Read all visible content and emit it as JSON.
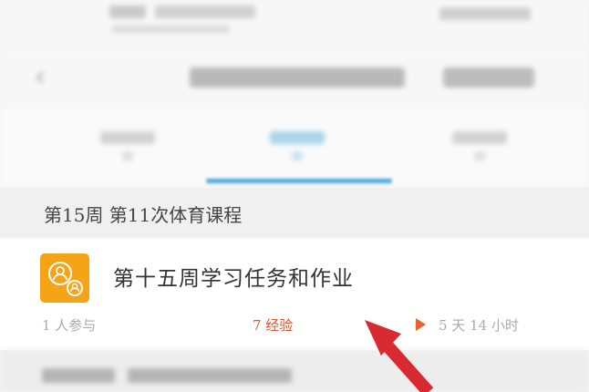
{
  "section": {
    "title": "第15周  第11次体育课程"
  },
  "task": {
    "icon": "task-group-icon",
    "title": "第十五周学习任务和作业",
    "participants": "1 人参与",
    "experience": "7 经验",
    "deadline": "5 天 14 小时"
  },
  "colors": {
    "accent_orange": "#f5a418",
    "experience_red": "#d05b30",
    "tab_blue": "#49a9db",
    "arrow_red": "#d82a30"
  }
}
